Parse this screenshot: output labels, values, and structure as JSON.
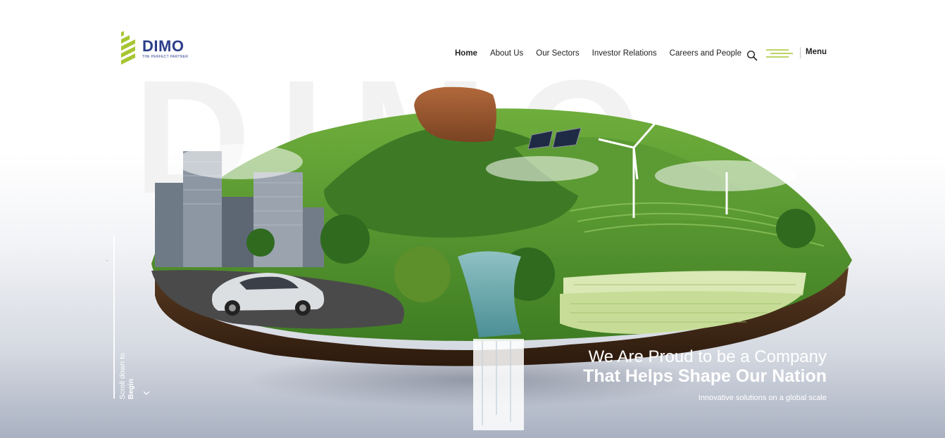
{
  "brand": {
    "name": "DIMO",
    "tagline": "THE PERFECT PARTNER",
    "color": "#2c3e8a",
    "accent": "#a6c632"
  },
  "watermark": "DIMO",
  "nav": {
    "items": [
      {
        "label": "Home",
        "active": true
      },
      {
        "label": "About Us"
      },
      {
        "label": "Our Sectors"
      },
      {
        "label": "Investor Relations"
      },
      {
        "label": "Careers and People"
      }
    ],
    "search_icon": "search-icon",
    "menu_icon": "hamburger-icon",
    "menu_label": "Menu"
  },
  "hero": {
    "headline_line1": "We Are Proud to be a Company",
    "headline_line2": "That Helps Shape Our Nation",
    "subline": "Innovative solutions on a global scale",
    "scroll_line1": "Scroll down to",
    "scroll_line2": "Begin",
    "scroll_marker": "-",
    "scroll_icon": "chevron-down-icon"
  }
}
